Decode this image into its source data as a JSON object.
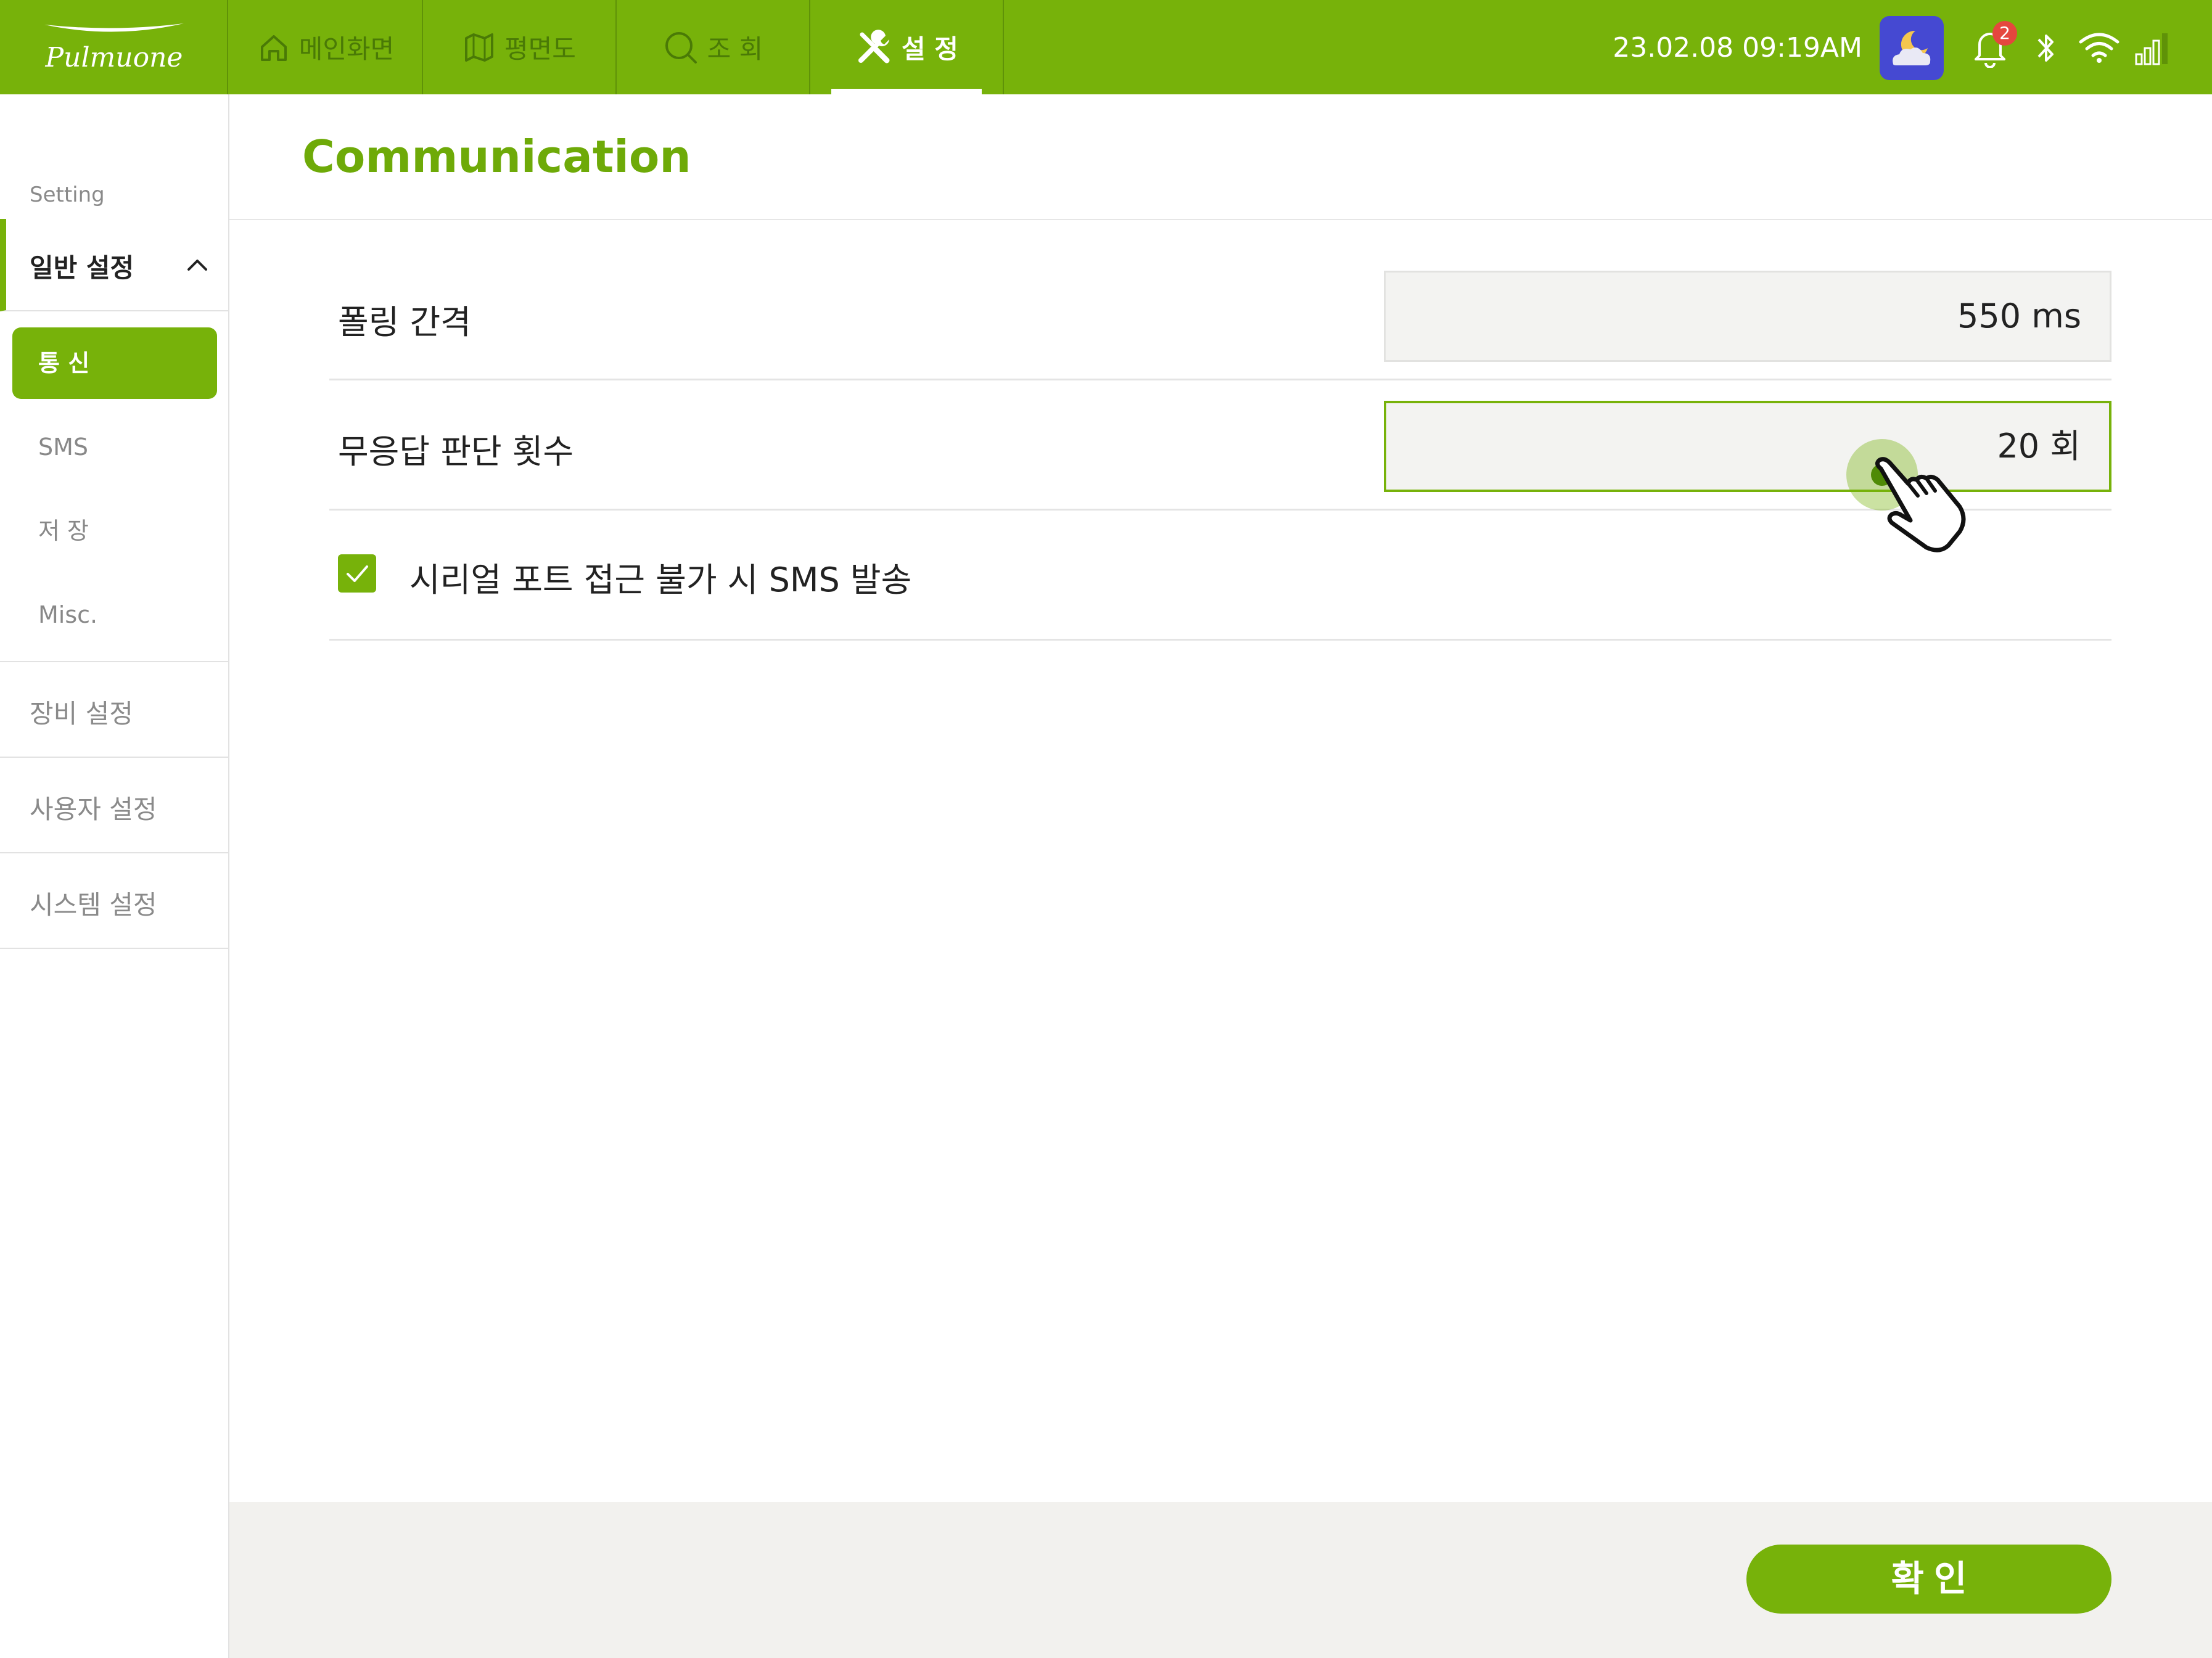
{
  "brand": {
    "logo_text": "Pulmuone"
  },
  "nav": {
    "tabs": [
      {
        "label": "메인화면",
        "icon": "home-icon"
      },
      {
        "label": "평면도",
        "icon": "floorplan-icon"
      },
      {
        "label": "조 회",
        "icon": "search-icon"
      },
      {
        "label": "설 정",
        "icon": "tools-icon",
        "active": true
      }
    ]
  },
  "status": {
    "datetime": "23.02.08  09:19AM",
    "weather_icon": "night-cloud-moon-icon",
    "notification_count": "2",
    "icons": [
      "bell-icon",
      "bluetooth-icon",
      "wifi-icon",
      "signal-icon"
    ]
  },
  "sidebar": {
    "section_label": "Setting",
    "group": {
      "label": "일반 설정",
      "expanded": true
    },
    "sub_items": [
      {
        "label": "통 신",
        "active": true
      },
      {
        "label": "SMS"
      },
      {
        "label": "저 장"
      },
      {
        "label": "Misc."
      }
    ],
    "items": [
      {
        "label": "장비 설정"
      },
      {
        "label": "사용자 설정"
      },
      {
        "label": "시스템 설정"
      }
    ]
  },
  "main": {
    "title": "Communication",
    "settings": [
      {
        "label": "폴링 간격",
        "value": "550 ms"
      },
      {
        "label": "무응답 판단 횟수",
        "value": "20 회",
        "focused": true
      }
    ],
    "checkbox": {
      "label": "시리얼 포트 접근 불가 시 SMS 발송",
      "checked": true
    }
  },
  "footer": {
    "confirm_label": "확 인"
  },
  "colors": {
    "brand_green": "#77b20a",
    "title_green": "#6eaa08",
    "badge_red": "#e5473e",
    "weather_bg": "#4549d2",
    "footer_bg": "#f2f1ee"
  }
}
